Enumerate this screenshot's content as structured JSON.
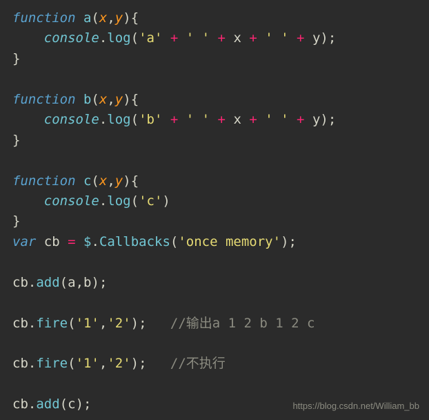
{
  "code": {
    "fn_a_sig": {
      "kw": "function",
      "name": "a",
      "p1": "x",
      "p2": "y"
    },
    "fn_a_body": {
      "obj": "console",
      "method": "log",
      "s1": "'a'",
      "s2": "' '",
      "v1": "x",
      "s3": "' '",
      "v2": "y"
    },
    "fn_b_sig": {
      "kw": "function",
      "name": "b",
      "p1": "x",
      "p2": "y"
    },
    "fn_b_body": {
      "obj": "console",
      "method": "log",
      "s1": "'b'",
      "s2": "' '",
      "v1": "x",
      "s3": "' '",
      "v2": "y"
    },
    "fn_c_sig": {
      "kw": "function",
      "name": "c",
      "p1": "x",
      "p2": "y"
    },
    "fn_c_body": {
      "obj": "console",
      "method": "log",
      "s1": "'c'"
    },
    "var_decl": {
      "kw": "var",
      "name": "cb",
      "dollar": "$",
      "method": "Callbacks",
      "arg": "'once memory'"
    },
    "add1": {
      "obj": "cb",
      "method": "add",
      "a1": "a",
      "a2": "b"
    },
    "fire1": {
      "obj": "cb",
      "method": "fire",
      "a1": "'1'",
      "a2": "'2'",
      "comment": "//输出a 1 2 b 1 2 c"
    },
    "fire2": {
      "obj": "cb",
      "method": "fire",
      "a1": "'1'",
      "a2": "'2'",
      "comment": "//不执行"
    },
    "add2": {
      "obj": "cb",
      "method": "add",
      "a1": "c"
    }
  },
  "punct": {
    "lparen": "(",
    "rparen": ")",
    "lbrace": "{",
    "rbrace": "}",
    "comma": ",",
    "dot": ".",
    "semi": ";",
    "eq": "=",
    "plus": "+"
  },
  "watermark": "https://blog.csdn.net/William_bb"
}
